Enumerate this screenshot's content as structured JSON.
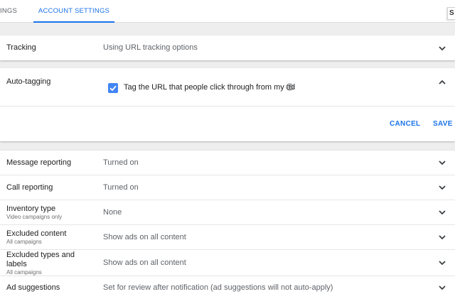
{
  "tabs": {
    "settings_partial": "ttings",
    "account_settings": "Account settings",
    "corner": "S"
  },
  "tracking": {
    "label": "Tracking",
    "value": "Using URL tracking options"
  },
  "autotagging": {
    "label": "Auto-tagging",
    "checkbox_label": "Tag the URL that people click through from my ad",
    "checked": true,
    "cancel": "Cancel",
    "save": "Save"
  },
  "rows": [
    {
      "label": "Message reporting",
      "sub": "",
      "value": "Turned on"
    },
    {
      "label": "Call reporting",
      "sub": "",
      "value": "Turned on"
    },
    {
      "label": "Inventory type",
      "sub": "Video campaigns only",
      "value": "None"
    },
    {
      "label": "Excluded content",
      "sub": "All campaigns",
      "value": "Show ads on all content"
    },
    {
      "label": "Excluded types and labels",
      "sub": "All campaigns",
      "value": "Show ads on all content"
    },
    {
      "label": "Ad suggestions",
      "sub": "",
      "value": "Set for review after notification (ad suggestions will not auto-apply)"
    }
  ],
  "colors": {
    "accent": "#1a73e8",
    "checkbox": "#4285f4",
    "background": "#eeeeee"
  },
  "icons": {
    "expand": "chevron-down-icon",
    "collapse": "chevron-up-icon",
    "help": "help-circle-icon",
    "check": "check-icon"
  }
}
